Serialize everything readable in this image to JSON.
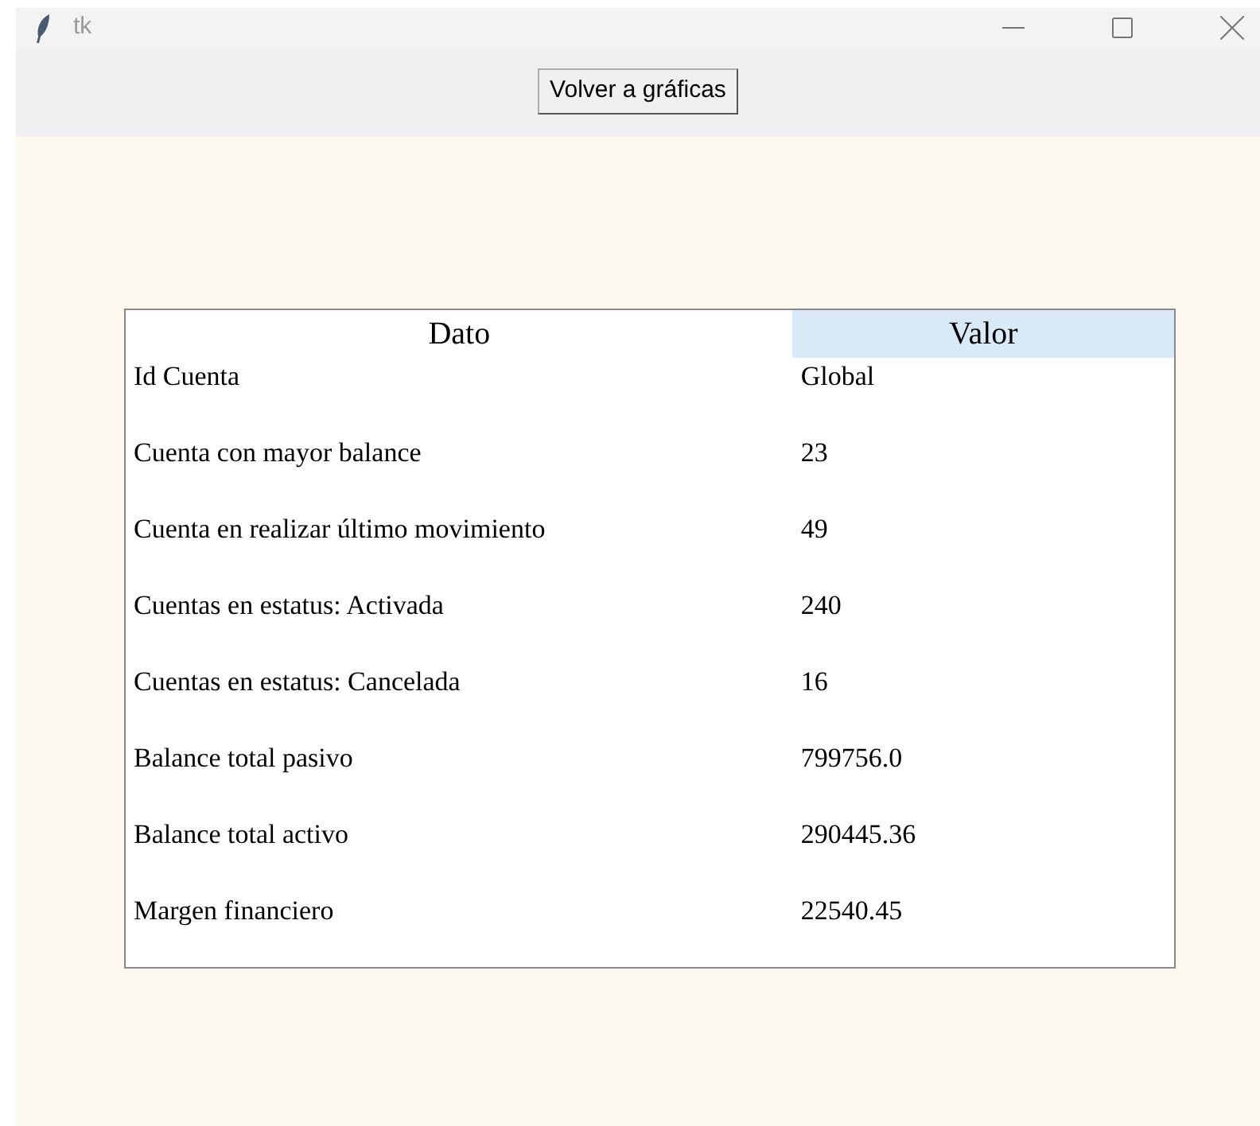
{
  "window": {
    "title": "tk"
  },
  "back_button": {
    "label": "Volver a gráficas"
  },
  "table": {
    "columns": [
      {
        "label": "Dato",
        "selected": false
      },
      {
        "label": "Valor",
        "selected": true
      }
    ],
    "rows": [
      [
        "Id Cuenta",
        "Global"
      ],
      [
        "Cuenta con mayor balance",
        "23"
      ],
      [
        "Cuenta en realizar último movimiento",
        "49"
      ],
      [
        "Cuentas en estatus: Activada",
        "240"
      ],
      [
        "Cuentas en estatus: Cancelada",
        "16"
      ],
      [
        "Balance total pasivo",
        "799756.0"
      ],
      [
        "Balance total activo",
        "290445.36"
      ],
      [
        "Margen financiero",
        "22540.45"
      ]
    ]
  }
}
